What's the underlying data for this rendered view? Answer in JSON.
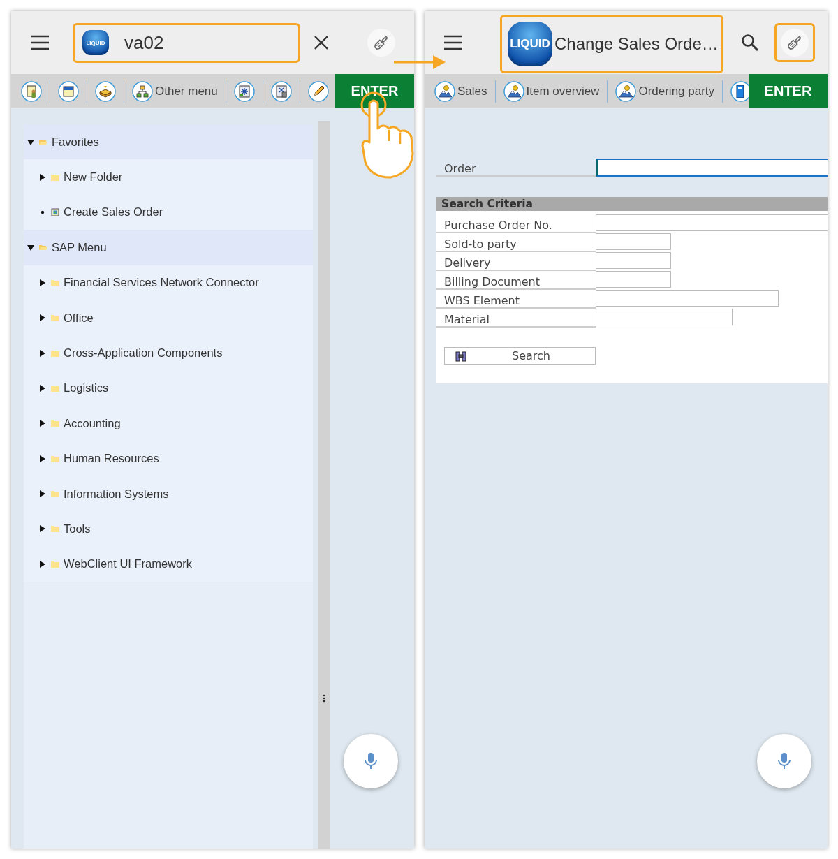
{
  "left_screen": {
    "header": {
      "logo": "LIQUID",
      "command": "va02",
      "command_highlighted": true,
      "paint_highlighted": false
    },
    "toolbar": {
      "items": [
        {
          "kind": "icon"
        },
        {
          "kind": "icon"
        },
        {
          "kind": "icon"
        },
        {
          "kind": "labeled",
          "label": "Other menu"
        },
        {
          "kind": "icon"
        },
        {
          "kind": "icon"
        },
        {
          "kind": "icon"
        }
      ],
      "enter": "ENTER"
    },
    "tree": [
      {
        "label": "Favorites",
        "kind": "folder",
        "expanded": true,
        "children": [
          {
            "label": "New Folder",
            "kind": "folder",
            "expanded": false
          },
          {
            "label": "Create Sales Order",
            "kind": "transaction"
          }
        ]
      },
      {
        "label": "SAP Menu",
        "kind": "folder",
        "expanded": true,
        "children": [
          {
            "label": "Financial Services Network Connector",
            "kind": "folder",
            "expanded": false
          },
          {
            "label": "Office",
            "kind": "folder",
            "expanded": false
          },
          {
            "label": "Cross-Application Components",
            "kind": "folder",
            "expanded": false
          },
          {
            "label": "Logistics",
            "kind": "folder",
            "expanded": false
          },
          {
            "label": "Accounting",
            "kind": "folder",
            "expanded": false
          },
          {
            "label": "Human Resources",
            "kind": "folder",
            "expanded": false
          },
          {
            "label": "Information Systems",
            "kind": "folder",
            "expanded": false
          },
          {
            "label": "Tools",
            "kind": "folder",
            "expanded": false
          },
          {
            "label": "WebClient UI Framework",
            "kind": "folder",
            "expanded": false
          }
        ]
      }
    ]
  },
  "right_screen": {
    "header": {
      "logo": "LIQUID",
      "title": "Change Sales Orde…",
      "title_highlighted": true,
      "paint_highlighted": true
    },
    "toolbar": {
      "items": [
        {
          "kind": "labeled",
          "label": "Sales"
        },
        {
          "kind": "labeled",
          "label": "Item overview"
        },
        {
          "kind": "labeled",
          "label": "Ordering party"
        },
        {
          "kind": "icon"
        }
      ],
      "enter": "ENTER"
    },
    "form": {
      "order": {
        "label": "Order",
        "focused": true
      },
      "section": "Search Criteria",
      "fields": [
        {
          "label": "Purchase Order No.",
          "kind": "full"
        },
        {
          "label": "Sold-to party",
          "kind": "short"
        },
        {
          "label": "Delivery",
          "kind": "short"
        },
        {
          "label": "Billing Document",
          "kind": "short"
        },
        {
          "label": "WBS Element",
          "kind": "wide"
        },
        {
          "label": "Material",
          "kind": "medium"
        }
      ],
      "search_button": "Search"
    }
  }
}
